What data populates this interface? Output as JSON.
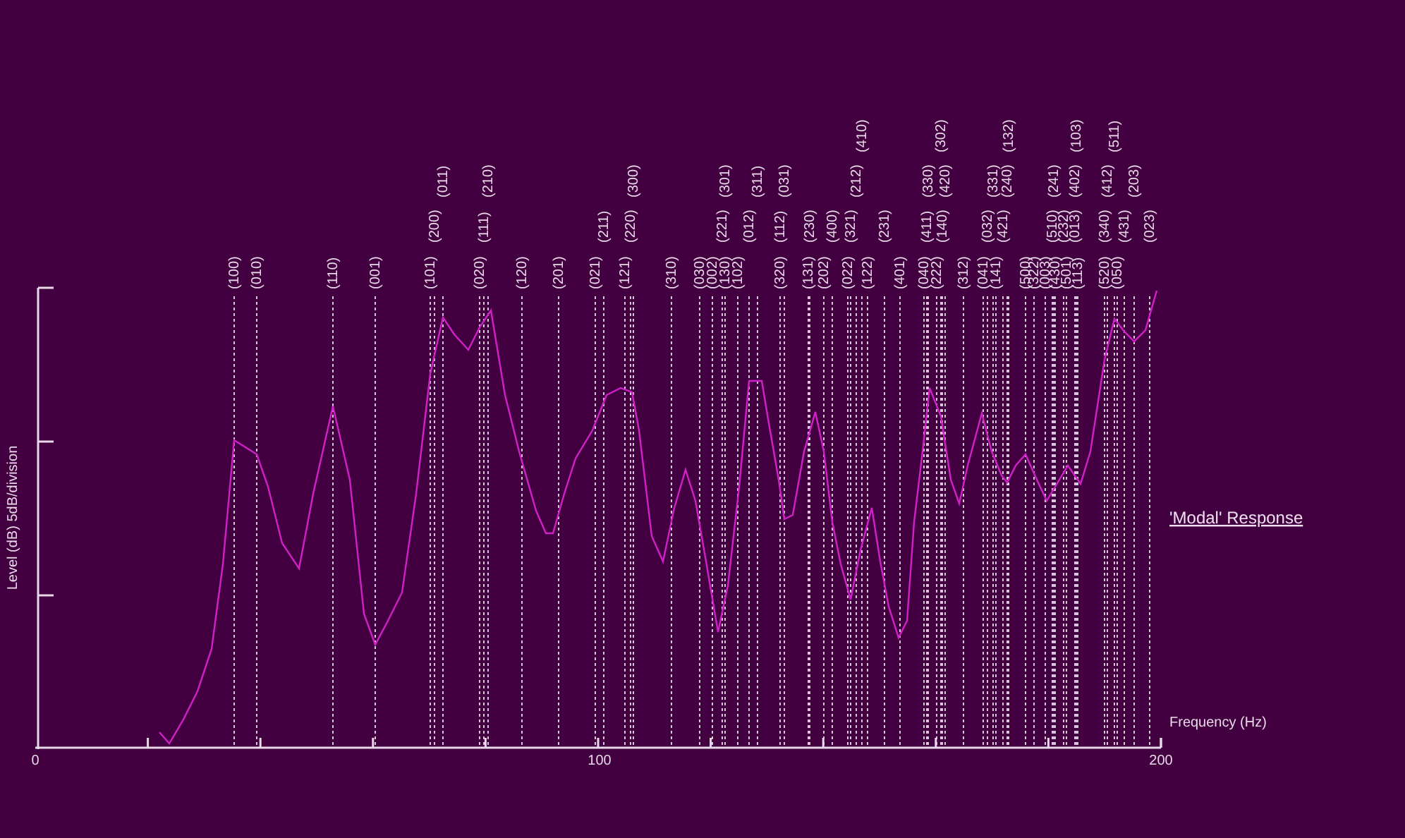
{
  "y_axis": {
    "label": "Level (dB) 5dB/division"
  },
  "x_axis": {
    "label": "Frequency (Hz)",
    "tick_labels": [
      "0",
      "100",
      "200"
    ]
  },
  "legend": {
    "label": "'Modal' Response"
  },
  "mode_labels": [
    "(100)",
    "(010)",
    "(110)",
    "(001)",
    "(101)",
    "(200)",
    "(011)",
    "(020)",
    "(111)",
    "(210)",
    "(120)",
    "(201)",
    "(021)",
    "(211)",
    "(121)",
    "(220)",
    "(300)",
    "(310)",
    "(030)",
    "(002)",
    "(130)",
    "(102)",
    "(221)",
    "(301)",
    "(012)",
    "(311)",
    "(320)",
    "(112)",
    "(031)",
    "(131)",
    "(230)",
    "(202)",
    "(400)",
    "(022)",
    "(321)",
    "(212)",
    "(410)",
    "(122)",
    "(231)",
    "(401)",
    "(040)",
    "(411)",
    "(330)",
    "(222)",
    "(140)",
    "(420)",
    "(302)",
    "(312)",
    "(041)",
    "(032)",
    "(331)",
    "(141)",
    "(421)",
    "(240)",
    "(132)",
    "(500)",
    "(322)",
    "(003)",
    "(510)",
    "(241)",
    "(430)",
    "(232)",
    "(501)",
    "(013)",
    "(402)",
    "(103)",
    "(113)",
    "(520)",
    "(340)",
    "(412)",
    "(511)",
    "(050)",
    "(431)",
    "(203)",
    "(023)"
  ]
}
